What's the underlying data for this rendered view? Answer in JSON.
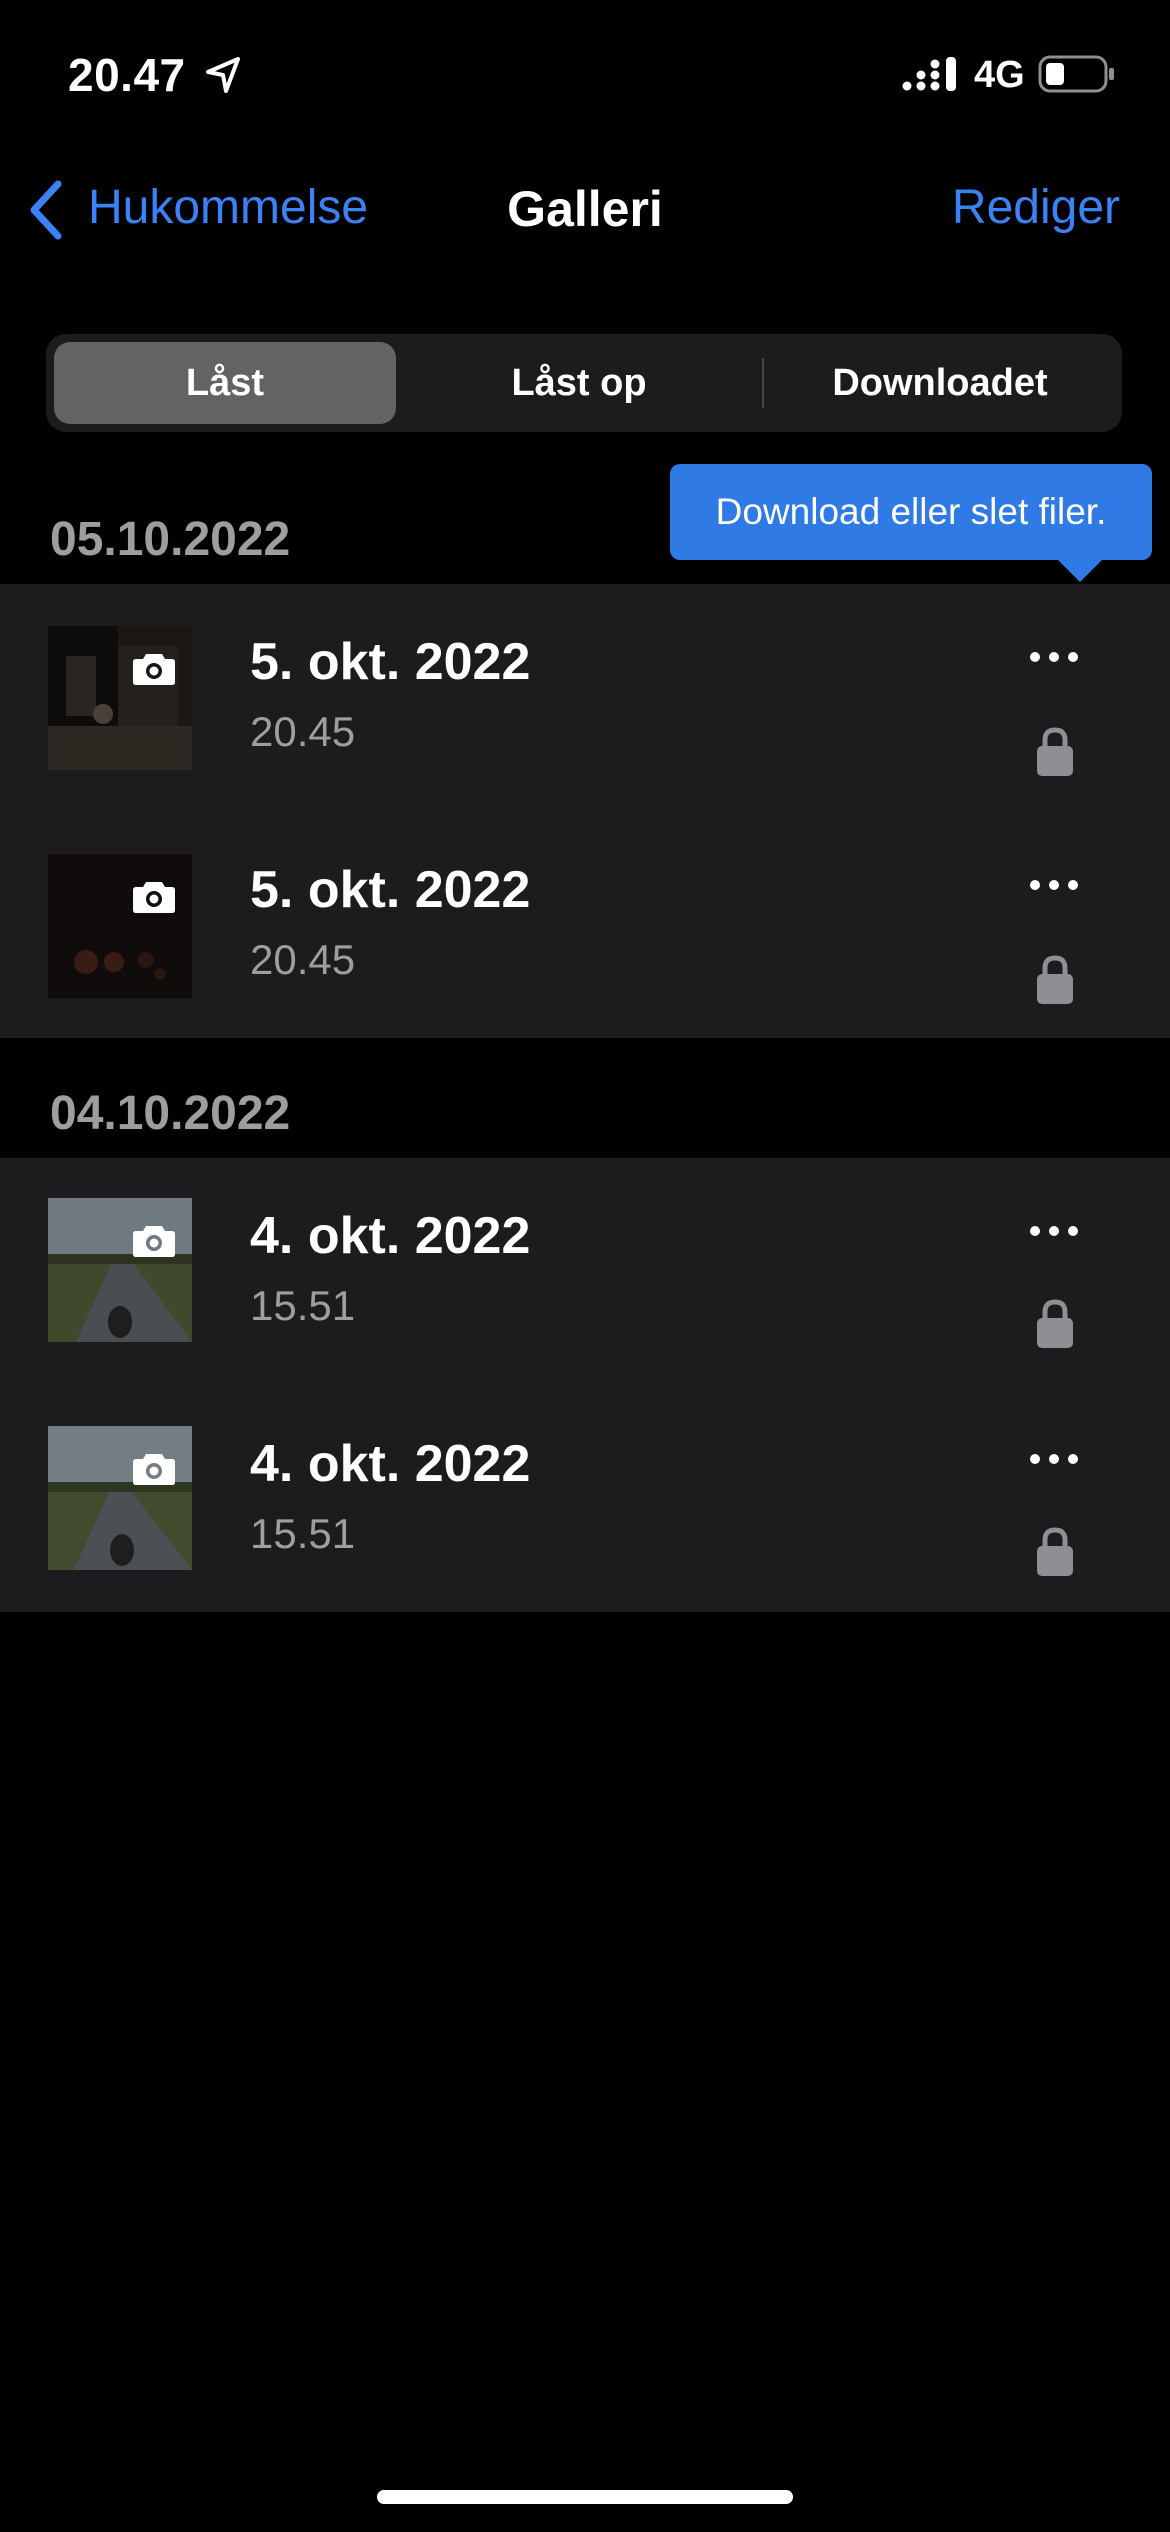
{
  "status_bar": {
    "time": "20.47",
    "network": "4G"
  },
  "nav": {
    "back_label": "Hukommelse",
    "title": "Galleri",
    "edit_label": "Rediger"
  },
  "tabs": [
    {
      "label": "Låst",
      "selected": true
    },
    {
      "label": "Låst op",
      "selected": false
    },
    {
      "label": "Downloadet",
      "selected": false
    }
  ],
  "tooltip": "Download eller slet filer.",
  "sections": [
    {
      "date": "05.10.2022",
      "items": [
        {
          "title": "5. okt. 2022",
          "time": "20.45",
          "thumb": "dark-room"
        },
        {
          "title": "5. okt. 2022",
          "time": "20.45",
          "thumb": "dark-lights"
        }
      ]
    },
    {
      "date": "04.10.2022",
      "items": [
        {
          "title": "4. okt. 2022",
          "time": "15.51",
          "thumb": "road"
        },
        {
          "title": "4. okt. 2022",
          "time": "15.51",
          "thumb": "road"
        }
      ]
    }
  ],
  "colors": {
    "accent": "#3b82f6",
    "tooltip": "#2f7ae5",
    "row_bg": "#1c1c1e",
    "secondary_text": "#9e9e9e"
  }
}
